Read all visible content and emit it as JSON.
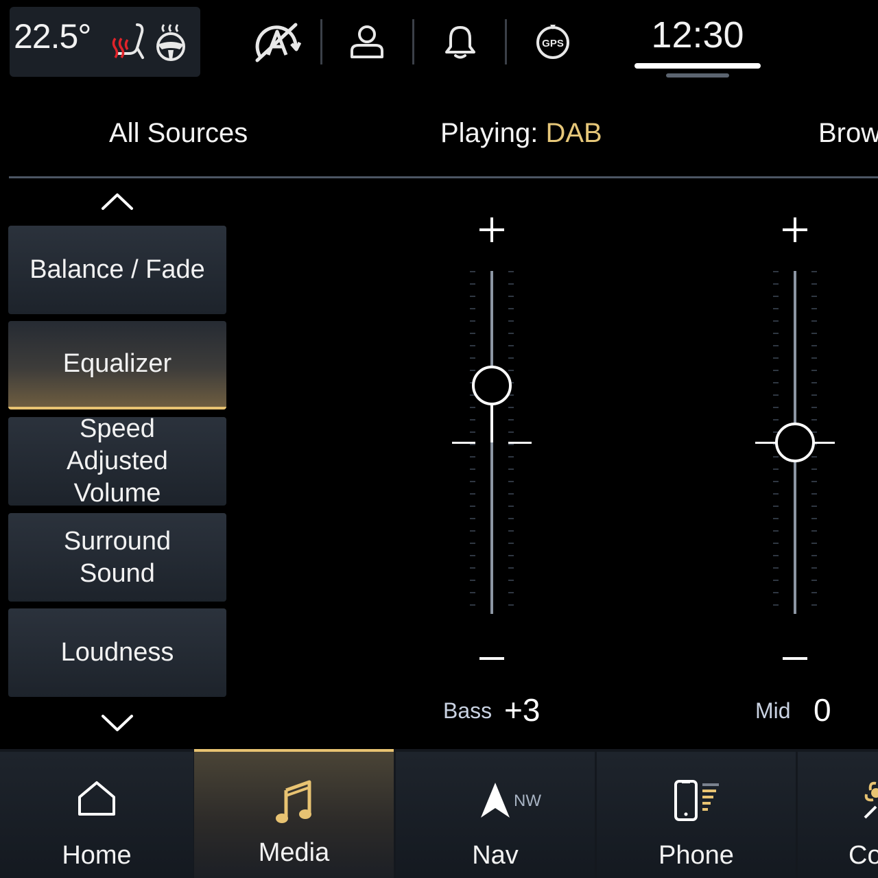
{
  "status_bar": {
    "temperature": "22.5°",
    "icons": [
      "heated-seat-icon",
      "heated-steering-wheel-icon",
      "auto-stop-off-icon",
      "profile-icon",
      "notification-bell-icon",
      "gps-icon"
    ],
    "gps_label": "GPS",
    "time": "12:30"
  },
  "tabs": {
    "all_sources": "All Sources",
    "playing_prefix": "Playing:",
    "playing_source": "DAB",
    "browse": "Brow"
  },
  "menu": {
    "items": [
      {
        "label": "Balance / Fade"
      },
      {
        "label": "Equalizer"
      },
      {
        "label": "Speed Adjusted Volume"
      },
      {
        "label": "Surround Sound"
      },
      {
        "label": "Loudness"
      }
    ],
    "active_index": 1
  },
  "equalizer": {
    "range": [
      -9,
      9
    ],
    "bands": [
      {
        "name": "Bass",
        "display": "+3",
        "value": 3
      },
      {
        "name": "Mid",
        "display": "0",
        "value": 0
      }
    ],
    "plus": "+",
    "minus": "–"
  },
  "bottom_nav": {
    "items": [
      {
        "label": "Home",
        "icon": "home-icon"
      },
      {
        "label": "Media",
        "icon": "music-note-icon"
      },
      {
        "label": "Nav",
        "icon": "navigation-arrow-icon",
        "heading": "NW"
      },
      {
        "label": "Phone",
        "icon": "phone-icon"
      },
      {
        "label": "Co",
        "icon": "fan-icon"
      }
    ],
    "active_index": 1
  },
  "colors": {
    "accent_gold": "#e8c372",
    "playing_highlight": "#e6c779",
    "button_bg": "#2b323c",
    "track": "#8c96a3"
  }
}
